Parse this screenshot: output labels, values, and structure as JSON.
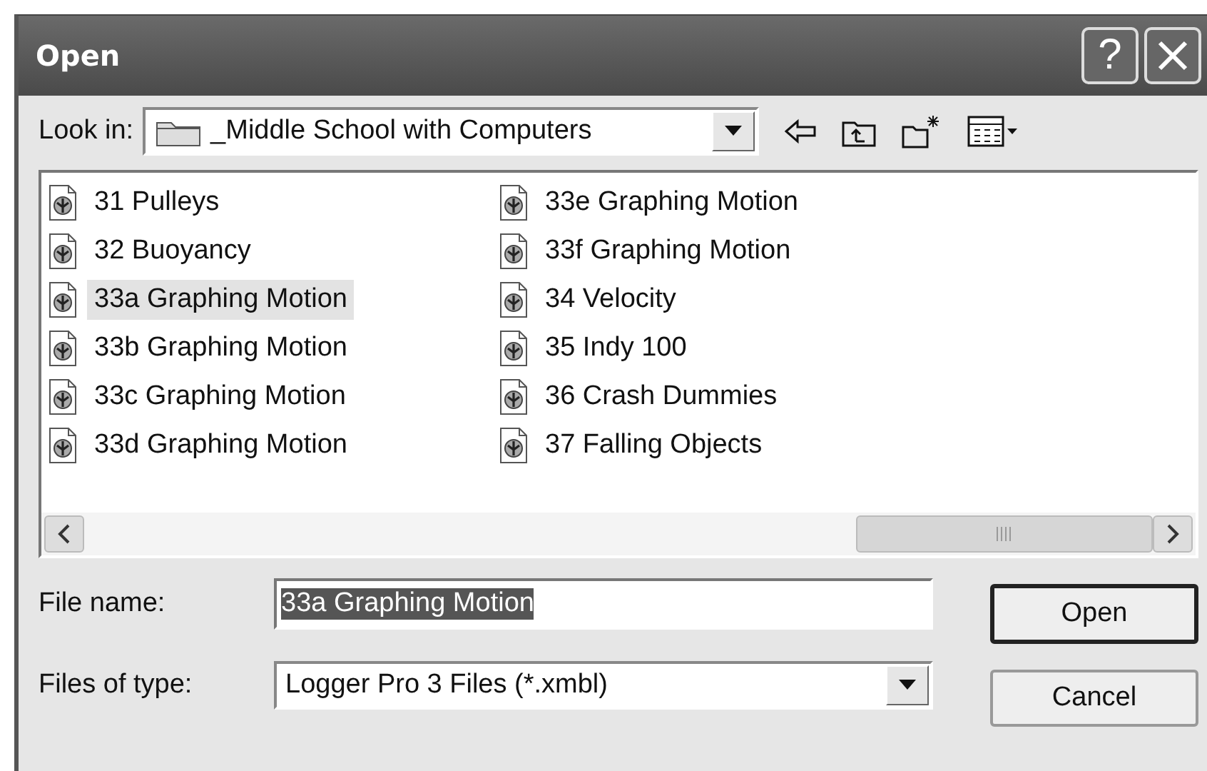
{
  "window": {
    "title": "Open",
    "help_glyph": "?"
  },
  "look_in": {
    "label": "Look in:",
    "value": "_Middle School with Computers"
  },
  "files": [
    {
      "name": "31 Pulleys",
      "selected": false
    },
    {
      "name": "32 Buoyancy",
      "selected": false
    },
    {
      "name": "33a Graphing Motion",
      "selected": true
    },
    {
      "name": "33b Graphing Motion",
      "selected": false
    },
    {
      "name": "33c Graphing Motion",
      "selected": false
    },
    {
      "name": "33d Graphing Motion",
      "selected": false
    },
    {
      "name": "33e Graphing Motion",
      "selected": false
    },
    {
      "name": "33f Graphing Motion",
      "selected": false
    },
    {
      "name": "34 Velocity",
      "selected": false
    },
    {
      "name": "35 Indy 100",
      "selected": false
    },
    {
      "name": "36 Crash Dummies",
      "selected": false
    },
    {
      "name": "37 Falling Objects",
      "selected": false
    }
  ],
  "file_name": {
    "label": "File name:",
    "value": "33a Graphing Motion",
    "highlighted": true
  },
  "files_of_type": {
    "label": "Files of type:",
    "value": "Logger Pro 3 Files (*.xmbl)"
  },
  "buttons": [
    {
      "label": "Open",
      "default": true
    },
    {
      "label": "Cancel",
      "default": false
    }
  ]
}
